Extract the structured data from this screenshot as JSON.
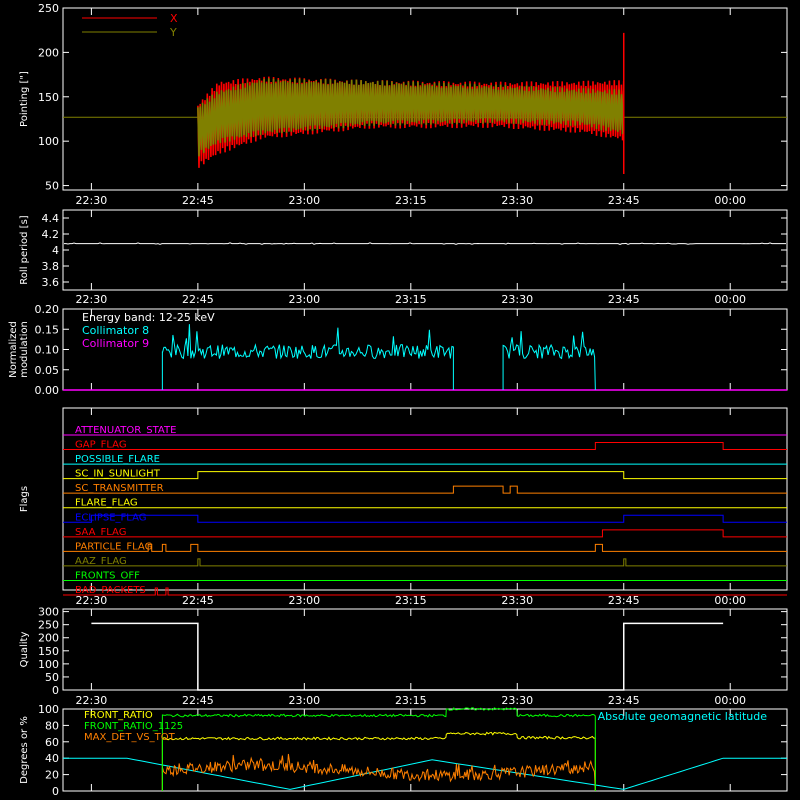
{
  "time_ticks": [
    "22:30",
    "22:45",
    "23:00",
    "23:15",
    "23:30",
    "23:45",
    "00:00"
  ],
  "chart_data": [
    {
      "type": "line",
      "ylabel": "Pointing [\"]",
      "yticks": [
        50,
        100,
        150,
        200,
        250
      ],
      "ylim": [
        45,
        250
      ],
      "legend": [
        {
          "name": "X",
          "color": "#ff0000"
        },
        {
          "name": "Y",
          "color": "#808000"
        }
      ],
      "series": [
        {
          "name": "X",
          "color": "#ff0000",
          "start": "22:45",
          "end": "23:45",
          "upper": [
            [
              0,
              140
            ],
            [
              0.05,
              165
            ],
            [
              0.15,
              170
            ],
            [
              0.4,
              166
            ],
            [
              0.7,
              164
            ],
            [
              0.9,
              165
            ],
            [
              1,
              166
            ]
          ],
          "lower": [
            [
              0,
              72
            ],
            [
              0.05,
              88
            ],
            [
              0.15,
              105
            ],
            [
              0.4,
              117
            ],
            [
              0.7,
              118
            ],
            [
              0.9,
              112
            ],
            [
              1,
              103
            ]
          ]
        },
        {
          "name": "Y",
          "color": "#808000",
          "start": "22:45",
          "end": "23:45",
          "upper": [
            [
              0,
              138
            ],
            [
              0.05,
              155
            ],
            [
              0.15,
              168
            ],
            [
              0.4,
              166
            ],
            [
              0.7,
              161
            ],
            [
              0.9,
              157
            ],
            [
              1,
              155
            ]
          ],
          "lower": [
            [
              0,
              85
            ],
            [
              0.05,
              100
            ],
            [
              0.15,
              110
            ],
            [
              0.4,
              120
            ],
            [
              0.7,
              123
            ],
            [
              0.9,
              120
            ],
            [
              1,
              110
            ]
          ]
        }
      ],
      "baseline": 127,
      "spike": {
        "time": "23:45",
        "max": 222,
        "min": 63
      }
    },
    {
      "type": "line",
      "ylabel": "Roll period [s]",
      "yticks": [
        3.6,
        3.8,
        4.0,
        4.2,
        4.4
      ],
      "ylim": [
        3.5,
        4.5
      ],
      "series": [
        {
          "name": "Roll period",
          "color": "#ffffff",
          "value": 4.08
        }
      ]
    },
    {
      "type": "line",
      "ylabel": "Normalized modulation",
      "yticks": [
        "0.00",
        "0.05",
        "0.10",
        "0.15",
        "0.20"
      ],
      "ylim": [
        0,
        0.2
      ],
      "annotation": "Energy band: 12-25 keV",
      "legend": [
        {
          "name": "Collimator 8",
          "color": "#00ffff"
        },
        {
          "name": "Collimator 9",
          "color": "#ff00ff"
        }
      ],
      "series": [
        {
          "name": "Collimator 8",
          "color": "#00ffff",
          "segments": [
            [
              "22:40",
              "23:21"
            ],
            [
              "23:28",
              "23:41"
            ]
          ],
          "mean": 0.095
        },
        {
          "name": "Collimator 9",
          "color": "#ff00ff",
          "value": 0
        }
      ]
    },
    {
      "type": "line",
      "ylabel": "Flags",
      "flags": [
        {
          "name": "ATTENUATOR_STATE",
          "color": "#ff00ff",
          "steps": []
        },
        {
          "name": "GAP_FLAG",
          "color": "#ff0000",
          "steps": [
            [
              "23:41",
              "23:59"
            ]
          ]
        },
        {
          "name": "POSSIBLE_FLARE",
          "color": "#00ffff",
          "steps": []
        },
        {
          "name": "SC_IN_SUNLIGHT",
          "color": "#ffff00",
          "steps": [
            [
              "22:45",
              "23:45"
            ]
          ]
        },
        {
          "name": "SC_TRANSMITTER",
          "color": "#ff8000",
          "steps": [
            [
              "23:21",
              "23:28"
            ],
            [
              "23:29",
              "23:30"
            ]
          ]
        },
        {
          "name": "FLARE_FLAG",
          "color": "#ffff00",
          "steps": []
        },
        {
          "name": "ECLIPSE_FLAG",
          "color": "#0000ff",
          "steps": [
            [
              "22:30",
              "22:45"
            ],
            [
              "23:45",
              "23:59"
            ]
          ]
        },
        {
          "name": "SAA_FLAG",
          "color": "#ff0000",
          "steps": [
            [
              "23:42",
              "23:59"
            ]
          ]
        },
        {
          "name": "PARTICLE_FLAG",
          "color": "#ff8000",
          "steps": [
            [
              "22:38",
              "22:38.5"
            ],
            [
              "22:40",
              "22:40.5"
            ],
            [
              "22:44",
              "22:45"
            ],
            [
              "23:41",
              "23:42"
            ]
          ]
        },
        {
          "name": "AAZ_FLAG",
          "color": "#808000",
          "steps": [
            [
              "22:45",
              "22:45.3"
            ],
            [
              "23:45",
              "23:45.3"
            ]
          ]
        },
        {
          "name": "FRONTS_OFF",
          "color": "#00ff00",
          "steps": []
        },
        {
          "name": "BAD_PACKETS",
          "color": "#ff0000",
          "steps": [
            [
              "22:39",
              "22:39.3"
            ],
            [
              "22:40.5",
              "22:40.8"
            ]
          ]
        }
      ]
    },
    {
      "type": "line",
      "ylabel": "Quality",
      "yticks": [
        0,
        50,
        100,
        150,
        200,
        250,
        300
      ],
      "ylim": [
        0,
        310
      ],
      "series": [
        {
          "name": "Quality",
          "color": "#ffffff",
          "segments": [
            [
              "22:30",
              "22:45",
              255
            ],
            [
              "22:45",
              "23:45",
              0
            ],
            [
              "23:45",
              "23:59",
              255
            ]
          ]
        }
      ]
    },
    {
      "type": "line",
      "ylabel": "Degrees or %",
      "yticks": [
        0,
        20,
        40,
        60,
        80,
        100
      ],
      "ylim": [
        0,
        100
      ],
      "legend": [
        {
          "name": "FRONT_RATIO",
          "color": "#ffff00"
        },
        {
          "name": "FRONT_RATIO_1125",
          "color": "#00ff00"
        },
        {
          "name": "MAX_DET_VS_TOT",
          "color": "#ff8000"
        }
      ],
      "right_label": {
        "text": "Absolute geomagnetic latitude",
        "color": "#00ffff"
      },
      "series": [
        {
          "name": "FRONT_RATIO",
          "color": "#ffff00",
          "segments": [
            [
              "22:40",
              "23:20",
              64
            ],
            [
              "23:20",
              "23:30",
              70
            ],
            [
              "23:30",
              "23:41",
              65
            ]
          ]
        },
        {
          "name": "FRONT_RATIO_1125",
          "color": "#00ff00",
          "segments": [
            [
              "22:40",
              "23:20",
              92
            ],
            [
              "23:20",
              "23:30",
              100
            ],
            [
              "23:30",
              "23:41",
              92
            ]
          ]
        },
        {
          "name": "MAX_DET_VS_TOT",
          "color": "#ff8000",
          "range": [
            "22:40",
            "23:41"
          ],
          "mean": 25
        },
        {
          "name": "Absolute geomagnetic latitude",
          "color": "#00ffff",
          "points": [
            [
              "22:30",
              40
            ],
            [
              "22:35",
              40
            ],
            [
              "22:58",
              2
            ],
            [
              "23:18",
              38
            ],
            [
              "23:45",
              2
            ],
            [
              "23:59",
              40
            ]
          ]
        }
      ]
    }
  ]
}
